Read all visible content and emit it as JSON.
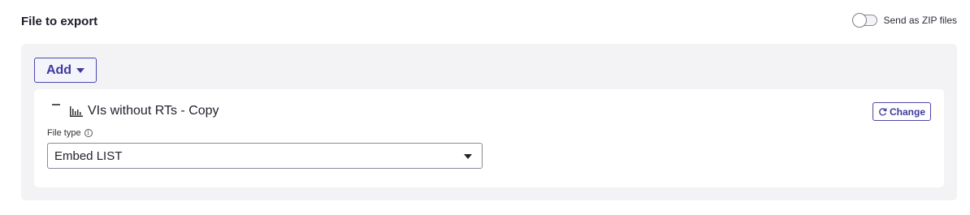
{
  "section": {
    "title": "File to export"
  },
  "zip_toggle": {
    "label": "Send as ZIP files",
    "enabled": false
  },
  "add_button": {
    "label": "Add"
  },
  "export_item": {
    "name": "VIs without RTs - Copy",
    "icon": "bar-chart-icon",
    "change_label": "Change",
    "file_type_label": "File type",
    "file_type_value": "Embed LIST"
  },
  "colors": {
    "accent": "#3e3a9c",
    "panel_bg": "#f3f3f6"
  }
}
